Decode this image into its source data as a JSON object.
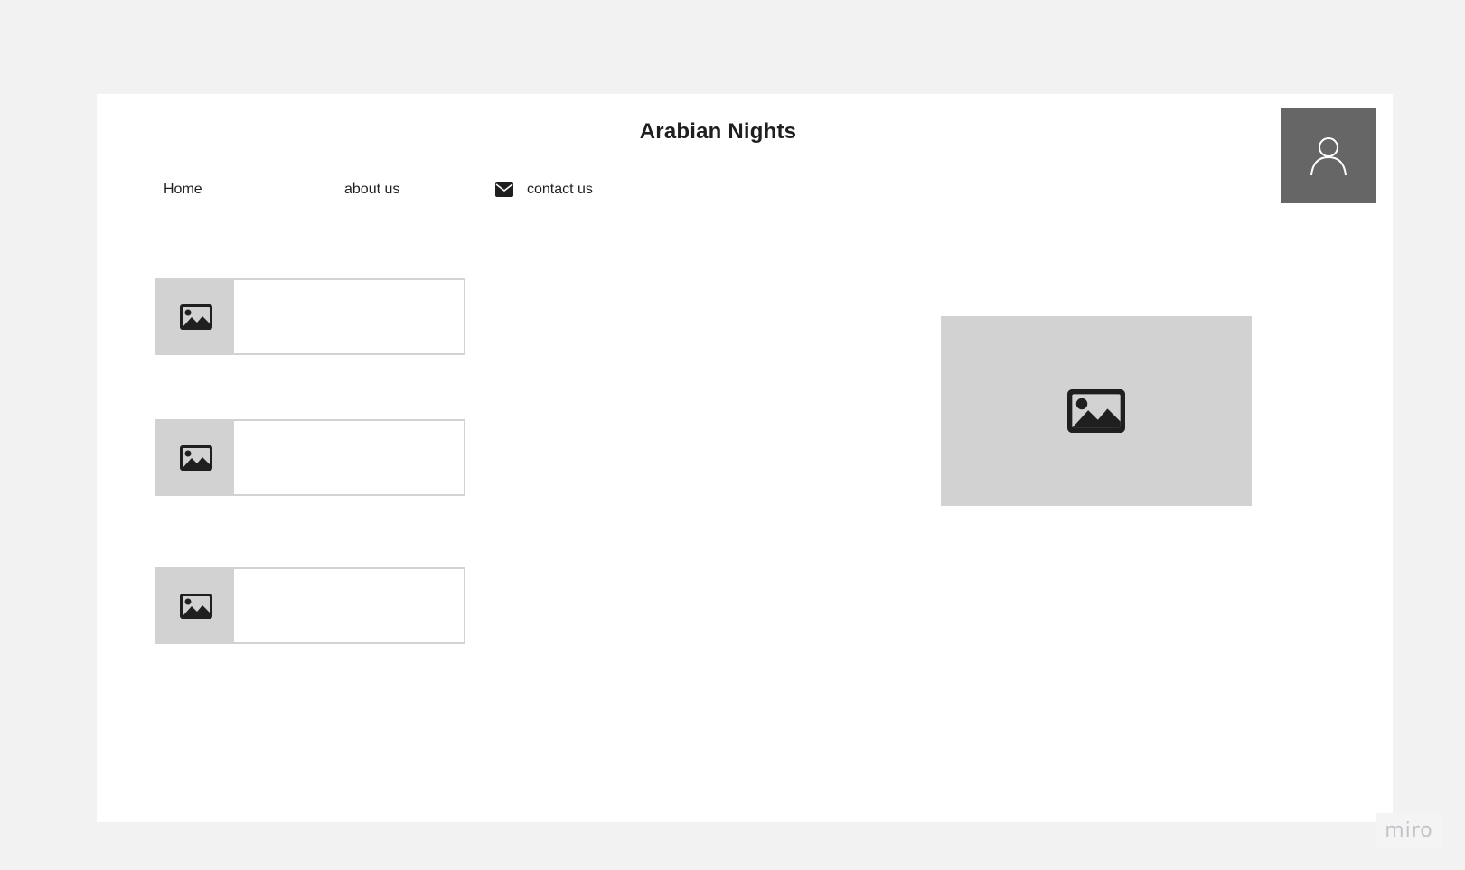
{
  "header": {
    "title": "Arabian Nights",
    "avatar_icon": "user-icon"
  },
  "nav": {
    "items": [
      {
        "label": "Home"
      },
      {
        "label": "about us"
      },
      {
        "label": "contact us",
        "icon": "mail-icon"
      }
    ]
  },
  "cards": [
    {
      "icon": "image-icon",
      "text": ""
    },
    {
      "icon": "image-icon",
      "text": ""
    },
    {
      "icon": "image-icon",
      "text": ""
    }
  ],
  "hero": {
    "icon": "image-icon"
  },
  "branding": {
    "logo": "miro"
  },
  "colors": {
    "canvas": "#f2f2f2",
    "frame": "#ffffff",
    "placeholder": "#d2d2d2",
    "avatar_bg": "#666666",
    "text": "#1f1f1f"
  }
}
